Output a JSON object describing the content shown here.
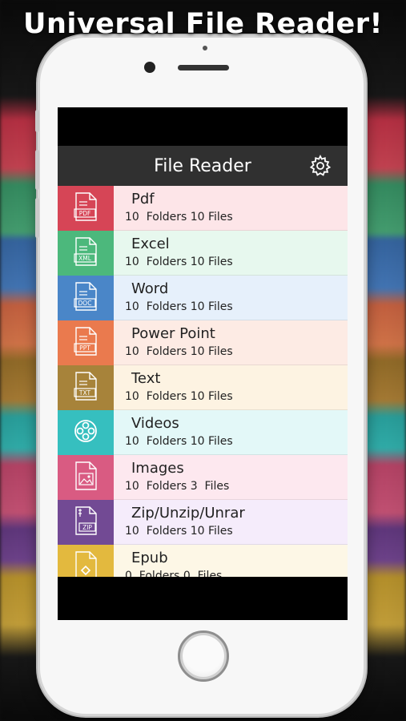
{
  "promo": {
    "headline": "Universal File Reader!"
  },
  "app": {
    "title": "File Reader",
    "settings_icon": "gear-icon"
  },
  "colors": {
    "navbar": "#303030",
    "pdf": "#d64556",
    "excel": "#4cb87c",
    "word": "#4a86c8",
    "powerpoint": "#ea7a4e",
    "text": "#a7833a",
    "videos": "#36bfbf",
    "images": "#d95b82",
    "zip": "#724a94",
    "epub": "#e3b93e"
  },
  "items": [
    {
      "name": "Pdf",
      "counts": "10  Folders 10 Files",
      "icon": "pdf-file-icon",
      "icon_label": "PDF",
      "color": "#d64556",
      "tint": "#fde5e8"
    },
    {
      "name": "Excel",
      "counts": "10  Folders 10 Files",
      "icon": "xml-file-icon",
      "icon_label": "XML",
      "color": "#4cb87c",
      "tint": "#e7f8ee"
    },
    {
      "name": "Word",
      "counts": "10  Folders 10 Files",
      "icon": "doc-file-icon",
      "icon_label": "DOC",
      "color": "#4a86c8",
      "tint": "#e6f0fb"
    },
    {
      "name": "Power Point",
      "counts": "10  Folders 10 Files",
      "icon": "ppt-file-icon",
      "icon_label": "PPT",
      "color": "#ea7a4e",
      "tint": "#fdebe4"
    },
    {
      "name": "Text",
      "counts": "10  Folders 10 Files",
      "icon": "txt-file-icon",
      "icon_label": "TXT",
      "color": "#a7833a",
      "tint": "#fdf3e2"
    },
    {
      "name": "Videos",
      "counts": "10  Folders 10 Files",
      "icon": "film-reel-icon",
      "icon_label": "",
      "color": "#36bfbf",
      "tint": "#e3f8f8"
    },
    {
      "name": "Images",
      "counts": "10  Folders 3  Files",
      "icon": "image-file-icon",
      "icon_label": "",
      "color": "#d95b82",
      "tint": "#fde8ef"
    },
    {
      "name": "Zip/Unzip/Unrar",
      "counts": "10  Folders 10 Files",
      "icon": "zip-file-icon",
      "icon_label": "ZIP",
      "color": "#724a94",
      "tint": "#f5ecfb"
    },
    {
      "name": "Epub",
      "counts": "0  Folders 0  Files",
      "icon": "epub-file-icon",
      "icon_label": "",
      "color": "#e3b93e",
      "tint": "#fdf7e6"
    }
  ]
}
